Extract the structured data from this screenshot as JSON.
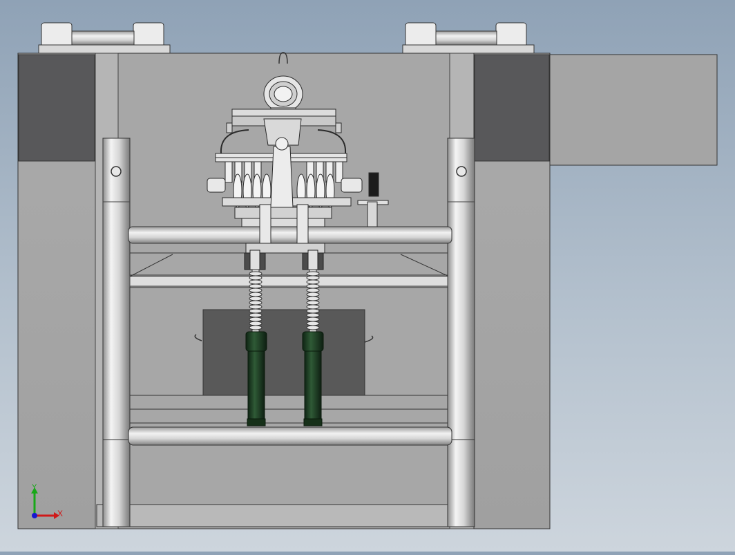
{
  "viewport": {
    "background_top": "#8fa2b6",
    "background_bottom": "#cdd5dd"
  },
  "model": {
    "plate_color": "#a6a6a6",
    "dark_block_color": "#58585a",
    "rod_color": "#dcdcdc",
    "cylinder_color": "#1f3d24",
    "spring_color": "#d0d0d0"
  },
  "triad": {
    "x_label": "X",
    "y_label": "Y",
    "x_color": "#d01818",
    "y_color": "#18a818",
    "z_color": "#1818d0"
  }
}
